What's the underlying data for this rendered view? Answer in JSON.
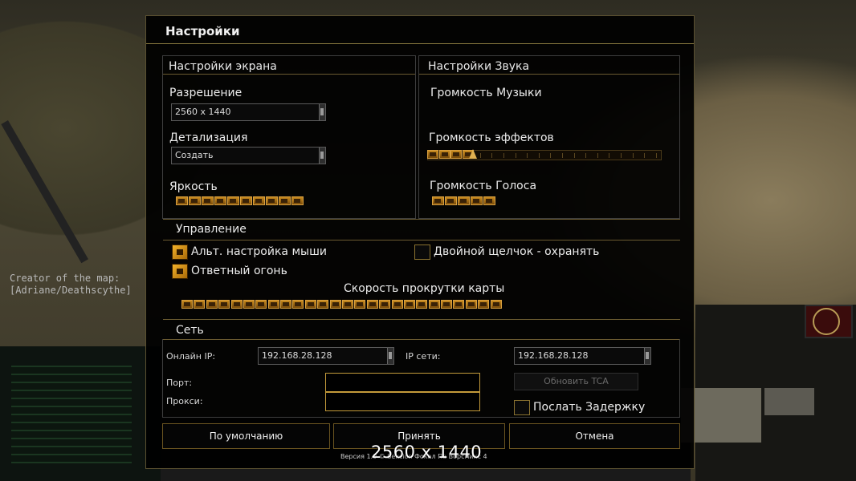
{
  "background": {
    "map_credit": {
      "line1": "Creator of the map:",
      "line2": "[Adriane/Deathscythe]"
    }
  },
  "dialog": {
    "title": "Настройки"
  },
  "screen_settings": {
    "heading": "Настройки экрана",
    "resolution_label": "Разрешение",
    "resolution_value": "2560 x 1440",
    "detail_label": "Детализация",
    "detail_value": "Создать",
    "brightness_label": "Яркость",
    "brightness_level": 10,
    "brightness_max": 10
  },
  "sound_settings": {
    "heading": "Настройки Звука",
    "music_label": "Громкость Музыки",
    "effects_label": "Громкость эффектов",
    "effects_level": 4,
    "effects_max": 20,
    "voice_label": "Громкость Голоса",
    "voice_level": 5,
    "voice_max": 5
  },
  "controls": {
    "heading": "Управление",
    "alt_mouse_label": "Альт. настройка мыши",
    "alt_mouse_checked": true,
    "double_click_label": "Двойной щелчок - охранять",
    "double_click_checked": false,
    "return_fire_label": "Ответный огонь",
    "return_fire_checked": true,
    "scroll_speed_label": "Скорость прокрутки карты",
    "scroll_speed_level": 26,
    "scroll_speed_max": 26
  },
  "network": {
    "heading": "Сеть",
    "online_ip_label": "Онлайн IP:",
    "online_ip_value": "192.168.28.128",
    "lan_ip_label": "IP сети:",
    "lan_ip_value": "192.168.28.128",
    "port_label": "Порт:",
    "port_value": "",
    "proxy_label": "Прокси:",
    "proxy_value": "",
    "refresh_tca_label": "Обновить TCA",
    "send_delay_label": "Послать Задержку",
    "send_delay_checked": false
  },
  "buttons": {
    "default_label": "По умолчанию",
    "accept_label": "Принять",
    "cancel_label": "Отмена"
  },
  "version_text": "Версия 1.0 © Sekcion Фокал Па Ворсмикс 4",
  "overlay_resolution": "2560 x 1440",
  "colors": {
    "accent": "#c88a1e",
    "border_gold": "#8a7a40",
    "panel_bg": "#000000"
  }
}
